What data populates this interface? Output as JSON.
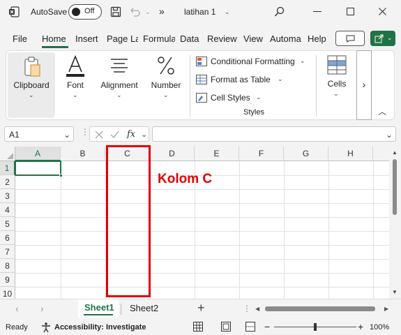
{
  "titlebar": {
    "autosave_label": "AutoSave",
    "autosave_state": "Off",
    "filename": "latihan 1",
    "more": "»"
  },
  "tabs": [
    "File",
    "Home",
    "Insert",
    "Page La",
    "Formula",
    "Data",
    "Review",
    "View",
    "Automa",
    "Help"
  ],
  "ribbon": {
    "clipboard": "Clipboard",
    "font": "Font",
    "alignment": "Alignment",
    "number": "Number",
    "conditional": "Conditional Formatting",
    "format_table": "Format as Table",
    "cell_styles": "Cell Styles",
    "styles_group": "Styles",
    "cells": "Cells",
    "more": "›"
  },
  "formula": {
    "namebox": "A1",
    "fx": "fx",
    "value": ""
  },
  "grid": {
    "columns": [
      "A",
      "B",
      "C",
      "D",
      "E",
      "F",
      "G",
      "H"
    ],
    "rows": [
      "1",
      "2",
      "3",
      "4",
      "5",
      "6",
      "7",
      "8",
      "9",
      "10"
    ],
    "annotation": "Kolom C"
  },
  "sheets": [
    "Sheet1",
    "Sheet2"
  ],
  "status": {
    "ready": "Ready",
    "accessibility": "Accessibility: Investigate",
    "zoom": "100%"
  },
  "colors": {
    "accent": "#217346",
    "annotation": "#e00000"
  }
}
